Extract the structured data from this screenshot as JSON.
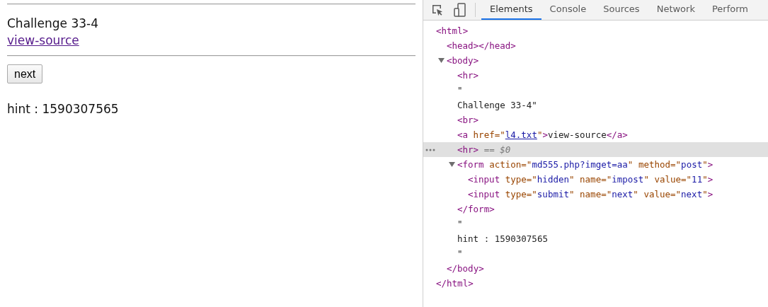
{
  "page": {
    "heading": "Challenge 33-4",
    "link": "view-source",
    "button": "next",
    "hint": "hint : 1590307565"
  },
  "devtools": {
    "tabs": [
      {
        "label": "Elements",
        "selected": true
      },
      {
        "label": "Console",
        "selected": false
      },
      {
        "label": "Sources",
        "selected": false
      },
      {
        "label": "Network",
        "selected": false
      },
      {
        "label": "Perform",
        "selected": false
      }
    ],
    "dom_tree": [
      {
        "selected": false,
        "tokens": [
          {
            "kind": "tag",
            "text": "<html>"
          }
        ],
        "children": [
          {
            "selected": false,
            "tokens": [
              {
                "kind": "tag",
                "text": "<head></head>"
              }
            ]
          },
          {
            "selected": false,
            "expanded": true,
            "tokens": [
              {
                "kind": "tag",
                "text": "<body>"
              }
            ],
            "children": [
              {
                "selected": false,
                "tokens": [
                  {
                    "kind": "tag",
                    "text": "<hr>"
                  }
                ]
              },
              {
                "selected": false,
                "tokens": [
                  {
                    "kind": "text",
                    "text": "\""
                  }
                ]
              },
              {
                "selected": false,
                "tokens": [
                  {
                    "kind": "text",
                    "text": "Challenge 33-4\""
                  }
                ]
              },
              {
                "selected": false,
                "tokens": [
                  {
                    "kind": "tag",
                    "text": "<br>"
                  }
                ]
              },
              {
                "selected": false,
                "tokens": [
                  {
                    "kind": "tag",
                    "text": "<a"
                  },
                  {
                    "kind": "attr",
                    "text": " href=\""
                  },
                  {
                    "kind": "link",
                    "text": "l4.txt"
                  },
                  {
                    "kind": "attr",
                    "text": "\""
                  },
                  {
                    "kind": "tag",
                    "text": ">"
                  },
                  {
                    "kind": "text",
                    "text": "view-source"
                  },
                  {
                    "kind": "tag",
                    "text": "</a>"
                  }
                ]
              },
              {
                "selected": true,
                "tokens": [
                  {
                    "kind": "tag",
                    "text": "<hr>"
                  },
                  {
                    "kind": "marker",
                    "text": " == $0"
                  }
                ]
              },
              {
                "selected": false,
                "expanded": true,
                "tokens": [
                  {
                    "kind": "tag",
                    "text": "<form"
                  },
                  {
                    "kind": "attr",
                    "text": " action=\""
                  },
                  {
                    "kind": "value",
                    "text": "md555.php?imget=aa"
                  },
                  {
                    "kind": "attr",
                    "text": "\" method=\""
                  },
                  {
                    "kind": "value",
                    "text": "post"
                  },
                  {
                    "kind": "attr",
                    "text": "\""
                  },
                  {
                    "kind": "tag",
                    "text": ">"
                  }
                ],
                "children": [
                  {
                    "selected": false,
                    "tokens": [
                      {
                        "kind": "tag",
                        "text": "<input"
                      },
                      {
                        "kind": "attr",
                        "text": " type=\""
                      },
                      {
                        "kind": "value",
                        "text": "hidden"
                      },
                      {
                        "kind": "attr",
                        "text": "\" name=\""
                      },
                      {
                        "kind": "value",
                        "text": "impost"
                      },
                      {
                        "kind": "attr",
                        "text": "\" value=\""
                      },
                      {
                        "kind": "value",
                        "text": "11"
                      },
                      {
                        "kind": "attr",
                        "text": "\""
                      },
                      {
                        "kind": "tag",
                        "text": ">"
                      }
                    ]
                  },
                  {
                    "selected": false,
                    "tokens": [
                      {
                        "kind": "tag",
                        "text": "<input"
                      },
                      {
                        "kind": "attr",
                        "text": " type=\""
                      },
                      {
                        "kind": "value",
                        "text": "submit"
                      },
                      {
                        "kind": "attr",
                        "text": "\" name=\""
                      },
                      {
                        "kind": "value",
                        "text": "next"
                      },
                      {
                        "kind": "attr",
                        "text": "\" value=\""
                      },
                      {
                        "kind": "value",
                        "text": "next"
                      },
                      {
                        "kind": "attr",
                        "text": "\""
                      },
                      {
                        "kind": "tag",
                        "text": ">"
                      }
                    ]
                  }
                ],
                "closing": [
                  {
                    "kind": "tag",
                    "text": "</form>"
                  }
                ]
              },
              {
                "selected": false,
                "tokens": [
                  {
                    "kind": "text",
                    "text": "\""
                  }
                ]
              },
              {
                "selected": false,
                "tokens": [
                  {
                    "kind": "text",
                    "text": "hint : 1590307565"
                  }
                ]
              },
              {
                "selected": false,
                "tokens": [
                  {
                    "kind": "text",
                    "text": "\""
                  }
                ]
              }
            ],
            "closing": [
              {
                "kind": "tag",
                "text": "</body>"
              }
            ]
          }
        ],
        "closing": [
          {
            "kind": "tag",
            "text": "</html>"
          }
        ]
      }
    ]
  }
}
